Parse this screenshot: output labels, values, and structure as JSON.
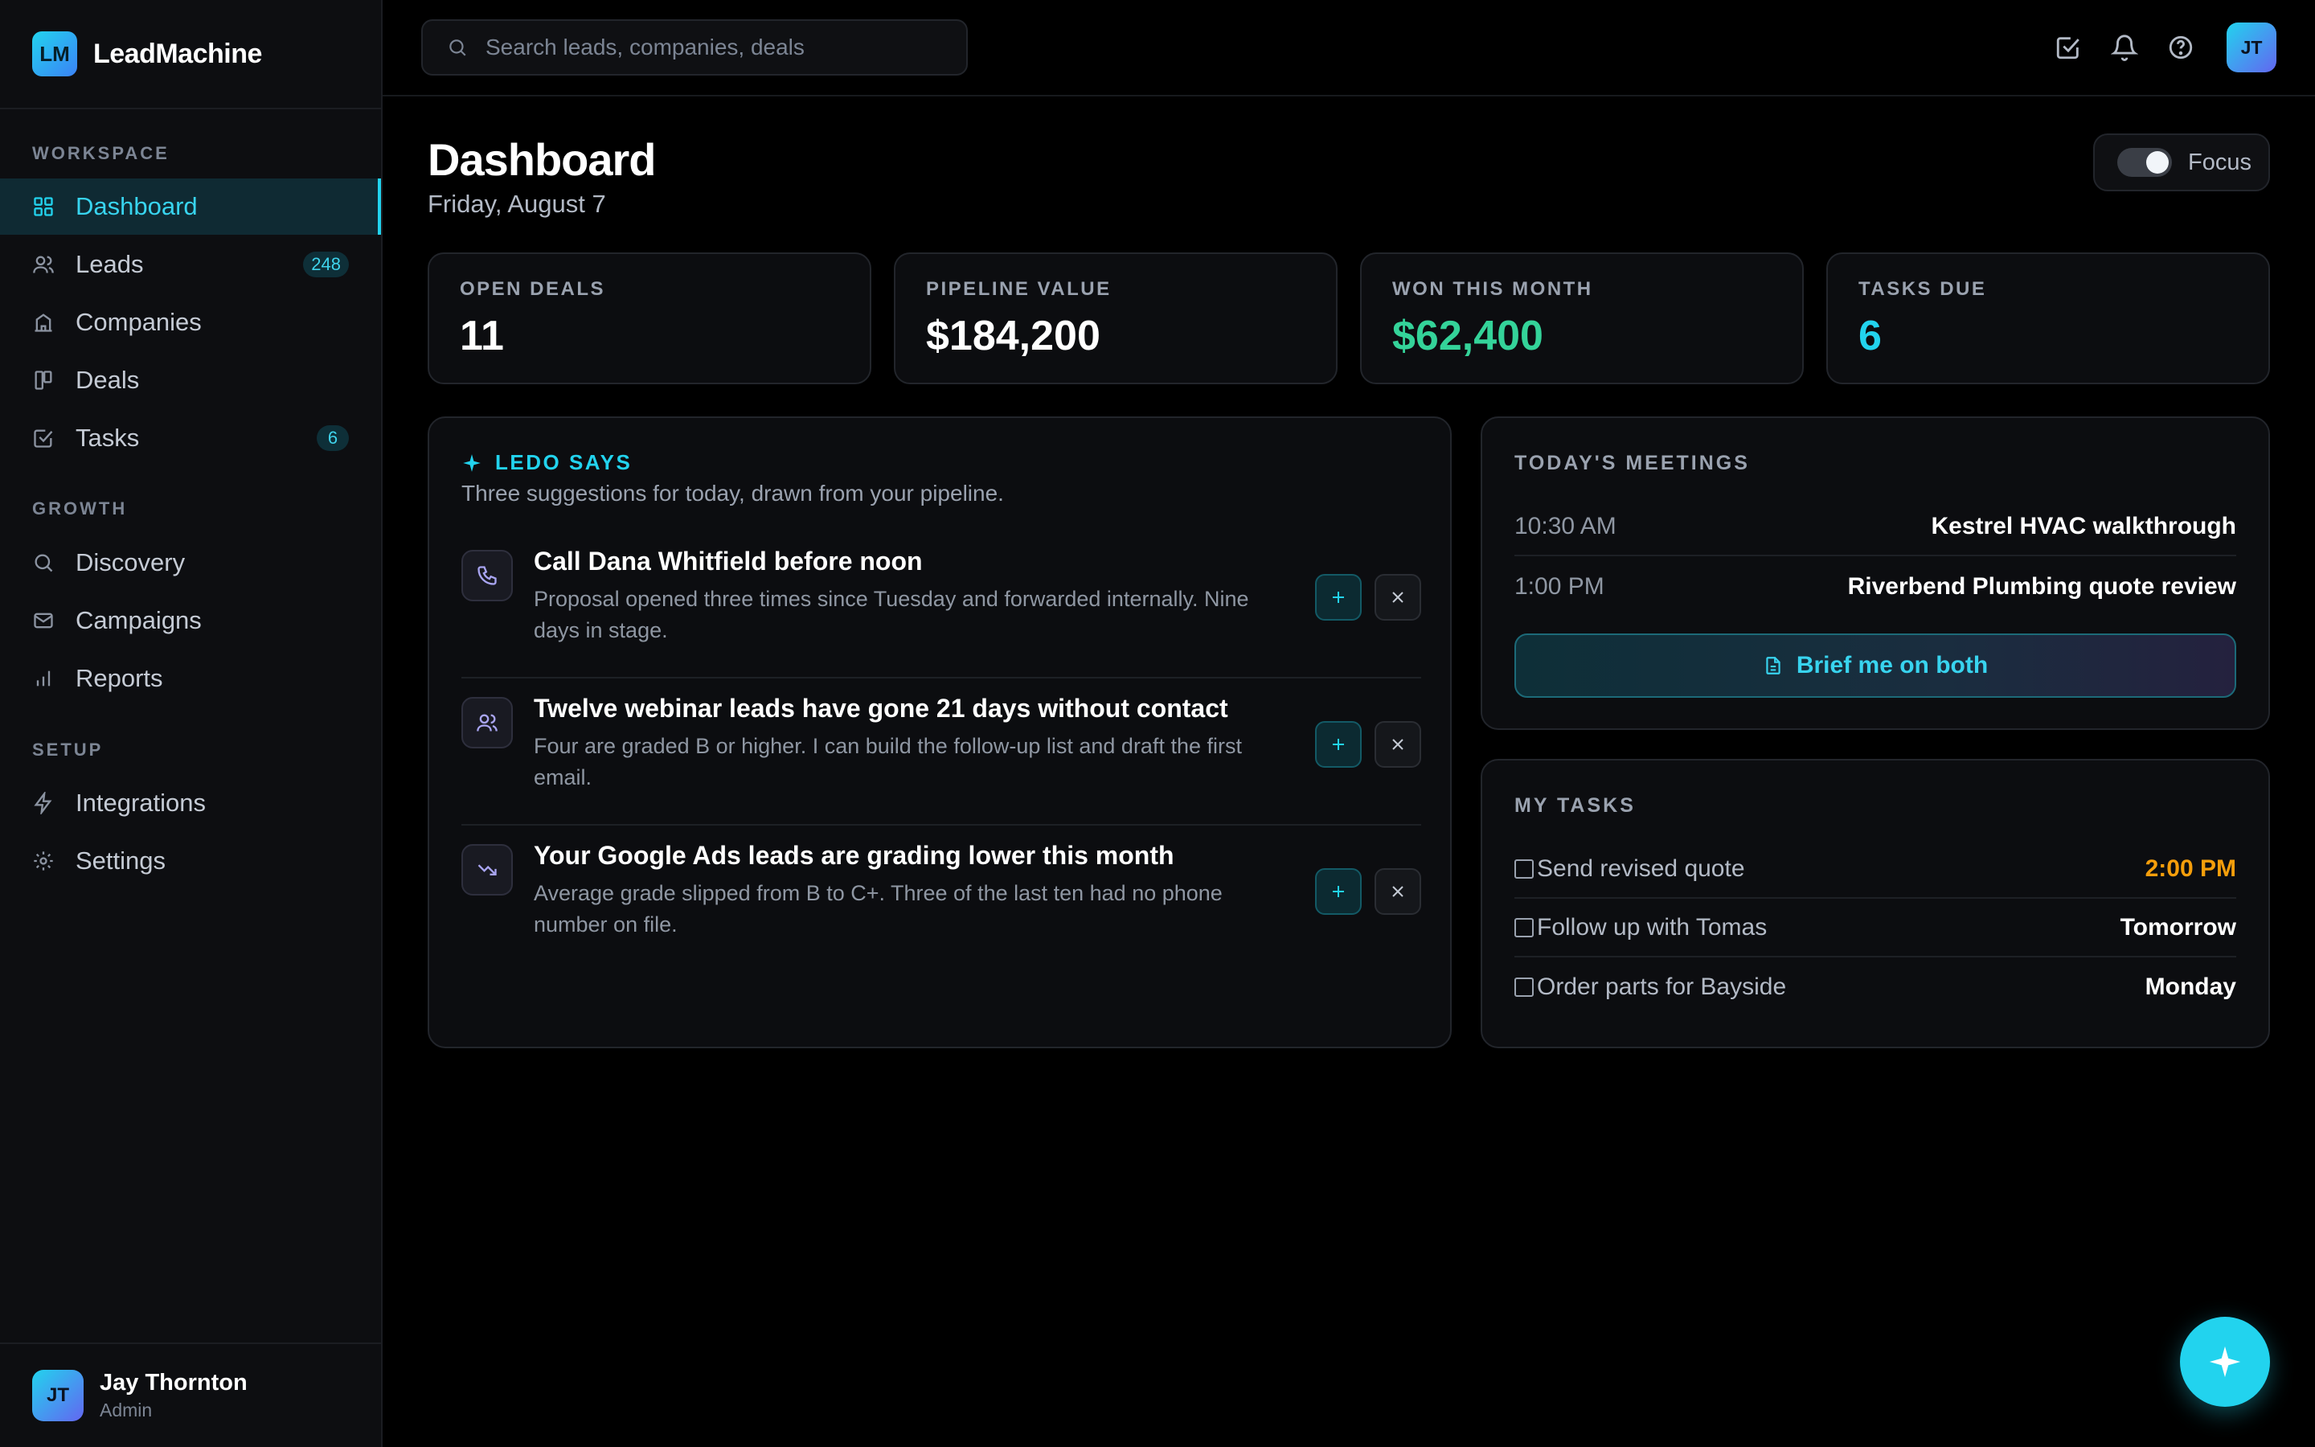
{
  "brand": {
    "logo": "LM",
    "name": "LeadMachine"
  },
  "sidebar": {
    "sections": [
      "WORKSPACE",
      "GROWTH",
      "SETUP"
    ],
    "items": [
      {
        "label": "Dashboard",
        "icon": "grid-icon",
        "active": true
      },
      {
        "label": "Leads",
        "icon": "users-icon",
        "badge": "248"
      },
      {
        "label": "Companies",
        "icon": "building-icon"
      },
      {
        "label": "Deals",
        "icon": "kanban-icon"
      },
      {
        "label": "Tasks",
        "icon": "check-square-icon",
        "badge": "6"
      },
      {
        "label": "Discovery",
        "icon": "search-icon"
      },
      {
        "label": "Campaigns",
        "icon": "mail-icon"
      },
      {
        "label": "Reports",
        "icon": "bar-chart-icon"
      },
      {
        "label": "Integrations",
        "icon": "bolt-icon"
      },
      {
        "label": "Settings",
        "icon": "gear-icon"
      }
    ],
    "user": {
      "initials": "JT",
      "name": "Jay Thornton",
      "role": "Admin"
    }
  },
  "topbar": {
    "search_placeholder": "Search leads, companies, deals",
    "avatar_initials": "JT",
    "icons": [
      "tasks-icon",
      "bell-icon",
      "help-icon"
    ]
  },
  "header": {
    "title": "Dashboard",
    "date": "Friday, August 7",
    "focus_label": "Focus",
    "focus_on": true
  },
  "stats": [
    {
      "label": "OPEN DEALS",
      "value": "11",
      "color": "#ffffff"
    },
    {
      "label": "PIPELINE VALUE",
      "value": "$184,200",
      "color": "#ffffff"
    },
    {
      "label": "WON THIS MONTH",
      "value": "$62,400",
      "color": "#34d399"
    },
    {
      "label": "TASKS DUE",
      "value": "6",
      "color": "#22d3ee"
    }
  ],
  "ledo": {
    "title": "LEDO SAYS",
    "subtitle": "Three suggestions for today, drawn from your pipeline.",
    "suggestions": [
      {
        "icon": "phone-icon",
        "title": "Call Dana Whitfield before noon",
        "desc": "Proposal opened three times since Tuesday and forwarded internally. Nine days in stage."
      },
      {
        "icon": "users-icon",
        "title": "Twelve webinar leads have gone 21 days without contact",
        "desc": "Four are graded B or higher. I can build the follow-up list and draft the first email."
      },
      {
        "icon": "trending-down-icon",
        "title": "Your Google Ads leads are grading lower this month",
        "desc": "Average grade slipped from B to C+. Three of the last ten had no phone number on file."
      }
    ]
  },
  "meetings": {
    "title": "TODAY'S MEETINGS",
    "items": [
      {
        "time": "10:30 AM",
        "title": "Kestrel HVAC walkthrough"
      },
      {
        "time": "1:00 PM",
        "title": "Riverbend Plumbing quote review"
      }
    ],
    "button": "Brief me on both"
  },
  "tasks": {
    "title": "MY TASKS",
    "items": [
      {
        "label": "Send revised quote",
        "due": "2:00 PM",
        "urgent": true
      },
      {
        "label": "Follow up with Tomas",
        "due": "Tomorrow",
        "urgent": false
      },
      {
        "label": "Order parts for Bayside",
        "due": "Monday",
        "urgent": false
      }
    ]
  },
  "colors": {
    "accent": "#22d3ee",
    "success": "#34d399",
    "warning": "#f59e0b",
    "background": "#000000"
  }
}
